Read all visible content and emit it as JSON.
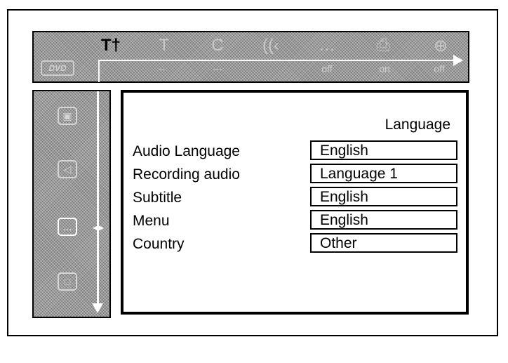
{
  "topbar": {
    "icons": [
      {
        "name": "tools-icon",
        "glyph": "T†",
        "active": true
      },
      {
        "name": "title-icon",
        "glyph": "T",
        "active": false
      },
      {
        "name": "chapter-icon",
        "glyph": "C",
        "active": false
      },
      {
        "name": "audio-icon",
        "glyph": "((‹",
        "active": false
      },
      {
        "name": "subtitle-icon",
        "glyph": "…",
        "active": false
      },
      {
        "name": "camera-angle-icon",
        "glyph": "⎙",
        "active": false
      },
      {
        "name": "zoom-icon",
        "glyph": "⊕",
        "active": false
      }
    ],
    "disc_badge": "DVD",
    "values": [
      "--",
      "---",
      "off",
      "on",
      "off"
    ]
  },
  "sidebar": {
    "items": [
      {
        "name": "picture-icon",
        "glyph": "▣",
        "active": false
      },
      {
        "name": "sound-icon",
        "glyph": "◁",
        "active": false
      },
      {
        "name": "language-icon",
        "glyph": "…",
        "active": true
      },
      {
        "name": "features-icon",
        "glyph": "□",
        "active": false
      }
    ],
    "nav_arrows": "◂▸"
  },
  "panel": {
    "title": "Language",
    "rows": [
      {
        "label": "Audio Language",
        "value": "English"
      },
      {
        "label": "Recording audio",
        "value": "Language 1"
      },
      {
        "label": "Subtitle",
        "value": "English"
      },
      {
        "label": "Menu",
        "value": "English"
      },
      {
        "label": "Country",
        "value": "Other"
      }
    ]
  }
}
